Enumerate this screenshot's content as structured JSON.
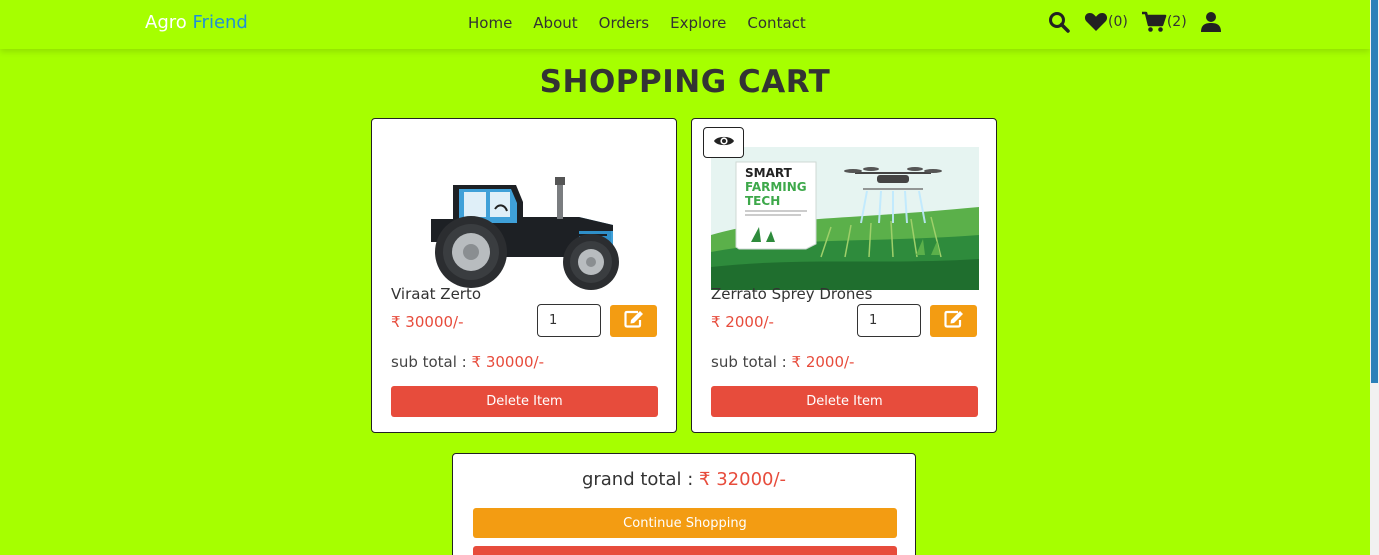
{
  "header": {
    "logo_part1": "Agro",
    "logo_part2": "Friend",
    "nav": [
      "Home",
      "About",
      "Orders",
      "Explore",
      "Contact"
    ],
    "wishlist_count": "(0)",
    "cart_count": "(2)",
    "icons": [
      "search-icon",
      "heart-icon",
      "cart-icon",
      "user-icon"
    ]
  },
  "title": "SHOPPING CART",
  "items": [
    {
      "name": "Viraat Zerto",
      "price": "₹ 30000/-",
      "qty": "1",
      "subtotal_label": "sub total :",
      "subtotal": "₹ 30000/-",
      "delete_label": "Delete Item",
      "image": "tractor"
    },
    {
      "name": "Zerrato Sprey Drones",
      "price": "₹ 2000/-",
      "qty": "1",
      "subtotal_label": "sub total :",
      "subtotal": "₹ 2000/-",
      "delete_label": "Delete Item",
      "image": "smart-farming-drone",
      "image_text": [
        "SMART",
        "FARMING",
        "TECH"
      ]
    }
  ],
  "totals": {
    "grand_label": "grand total :",
    "grand_value": "₹ 32000/-",
    "continue_label": "Continue Shopping"
  },
  "colors": {
    "background": "#a6ff00",
    "price": "#e74c3c",
    "accent_orange": "#f39c12",
    "danger": "#e74c3c",
    "logo_accent": "#1f8fd6"
  }
}
